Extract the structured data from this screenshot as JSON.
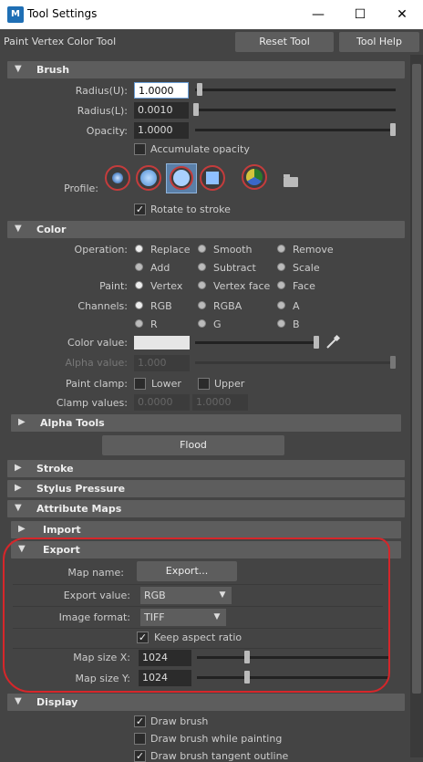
{
  "window": {
    "app_icon": "M",
    "title": "Tool Settings",
    "minimize": "—",
    "maximize": "☐",
    "close": "✕"
  },
  "tool": {
    "name": "Paint Vertex Color Tool",
    "reset_label": "Reset Tool",
    "help_label": "Tool Help"
  },
  "brush": {
    "header": "Brush",
    "radius_u_label": "Radius(U):",
    "radius_u": "1.0000",
    "radius_u_frac": 0.15,
    "radius_l_label": "Radius(L):",
    "radius_l": "0.0010",
    "radius_l_frac": 0.0,
    "opacity_label": "Opacity:",
    "opacity": "1.0000",
    "opacity_frac": 1.0,
    "accumulate_label": "Accumulate opacity",
    "accumulate_checked": false,
    "profile_label": "Profile:",
    "rotate_label": "Rotate to stroke",
    "rotate_checked": true
  },
  "color": {
    "header": "Color",
    "operation_label": "Operation:",
    "operations": [
      "Replace",
      "Smooth",
      "Remove",
      "Add",
      "Subtract",
      "Scale"
    ],
    "operation_selected": "Replace",
    "paint_label": "Paint:",
    "paint_options": [
      "Vertex",
      "Vertex face",
      "Face"
    ],
    "paint_selected": "Vertex",
    "channels_label": "Channels:",
    "channels": [
      "RGB",
      "RGBA",
      "A",
      "R",
      "G",
      "B"
    ],
    "channels_selected": "RGB",
    "color_value_label": "Color value:",
    "color_value_swatch": "#e6e6e6",
    "color_value_frac": 1.0,
    "alpha_value_label": "Alpha value:",
    "alpha_value": "1.000",
    "paint_clamp_label": "Paint clamp:",
    "clamp_lower": "Lower",
    "clamp_upper": "Upper",
    "clamp_values_label": "Clamp values:",
    "clamp_min": "0.0000",
    "clamp_max": "1.0000"
  },
  "alpha_tools": {
    "header": "Alpha Tools"
  },
  "flood_label": "Flood",
  "sections": {
    "stroke": "Stroke",
    "stylus": "Stylus Pressure",
    "attribute_maps": "Attribute Maps",
    "import": "Import",
    "export": "Export",
    "display": "Display"
  },
  "export": {
    "map_name_label": "Map name:",
    "export_button": "Export...",
    "export_value_label": "Export value:",
    "export_value": "RGB",
    "image_format_label": "Image format:",
    "image_format": "TIFF",
    "keep_aspect_label": "Keep aspect ratio",
    "keep_aspect_checked": true,
    "map_size_x_label": "Map size X:",
    "map_size_x": "1024",
    "map_size_y_label": "Map size Y:",
    "map_size_y": "1024"
  },
  "display": {
    "draw_brush": "Draw brush",
    "draw_brush_painting": "Draw brush while painting",
    "draw_brush_tangent": "Draw brush tangent outline"
  },
  "colors": {
    "annotation": "#d6262a",
    "selected_profile": "#5a7fa8"
  }
}
